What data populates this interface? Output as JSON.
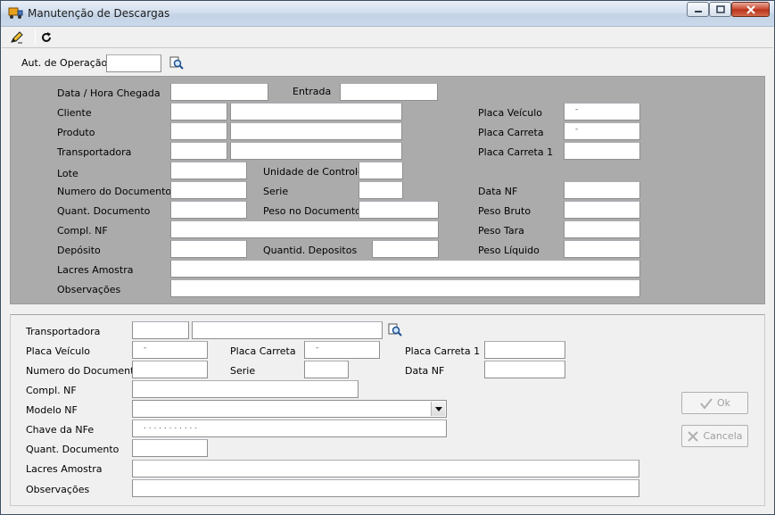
{
  "window": {
    "title": "Manutenção de Descargas"
  },
  "top": {
    "aut_operacao_label": "Aut. de Operação",
    "aut_operacao_value": ""
  },
  "upper": {
    "data_hora_chegada": "Data / Hora Chegada",
    "entrada": "Entrada",
    "cliente": "Cliente",
    "produto": "Produto",
    "transportadora": "Transportadora",
    "lote": "Lote",
    "unidade_controle": "Unidade de Controle",
    "numero_documento": "Numero do Documento",
    "serie": "Serie",
    "quant_documento": "Quant. Documento",
    "peso_documento": "Peso no Documento",
    "compl_nf": "Compl. NF",
    "deposito": "Depósito",
    "quantid_depositos": "Quantid. Depositos",
    "lacres_amostra": "Lacres Amostra",
    "observacoes": "Observações",
    "placa_veiculo": "Placa Veículo",
    "placa_carreta": "Placa Carreta",
    "placa_carreta_1": "Placa Carreta 1",
    "data_nf": "Data NF",
    "peso_bruto": "Peso Bruto",
    "peso_tara": "Peso Tara",
    "peso_liquido": "Peso Líquido",
    "placa_veiculo_value": "-",
    "placa_carreta_value": "-"
  },
  "lower": {
    "transportadora": "Transportadora",
    "placa_veiculo": "Placa Veículo",
    "placa_carreta": "Placa Carreta",
    "placa_carreta_1": "Placa Carreta 1",
    "numero_documento": "Numero do Documento",
    "serie": "Serie",
    "data_nf": "Data NF",
    "compl_nf": "Compl. NF",
    "modelo_nf": "Modelo NF",
    "chave_nfe": "Chave da NFe",
    "quant_documento": "Quant. Documento",
    "lacres_amostra": "Lacres Amostra",
    "observacoes": "Observações",
    "placa_veiculo_value": "-",
    "placa_carreta_value": "-",
    "chave_nfe_value": ". . . . . . . . . . ."
  },
  "buttons": {
    "ok": "Ok",
    "cancela": "Cancela"
  },
  "colors": {
    "panel_gray": "#ababab",
    "window_bg": "#f0f0f0",
    "close_red": "#c9462c"
  }
}
